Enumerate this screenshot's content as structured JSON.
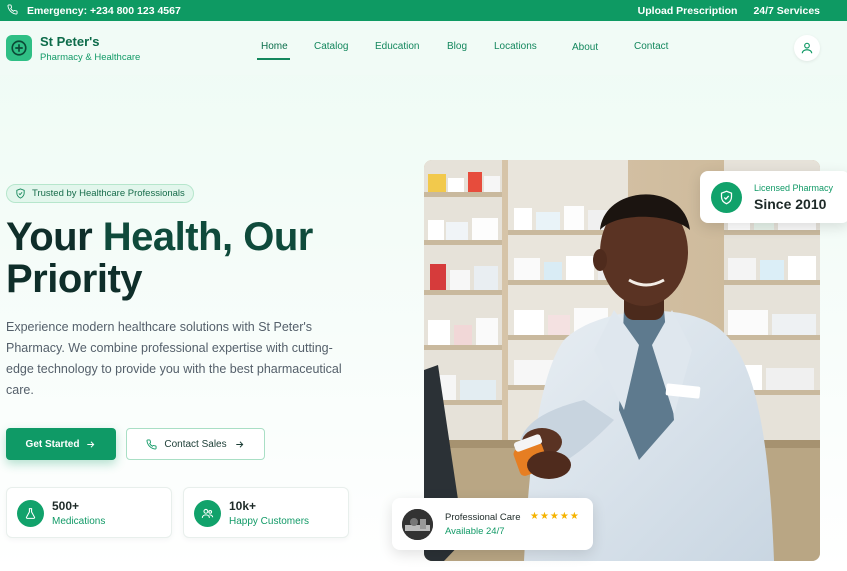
{
  "topbar": {
    "emergency": "Emergency: +234 800 123 4567",
    "upload": "Upload Prescription",
    "services": "24/7 Services"
  },
  "brand": {
    "name": "St Peter's",
    "tagline": "Pharmacy & Healthcare"
  },
  "nav": {
    "items": [
      {
        "label": "Home"
      },
      {
        "label": "Catalog"
      },
      {
        "label": "Education"
      },
      {
        "label": "Blog"
      },
      {
        "label": "Locations"
      },
      {
        "label": "About"
      },
      {
        "label": "Contact"
      }
    ],
    "active": "Home"
  },
  "hero": {
    "badge": "Trusted by Healthcare Professionals",
    "title_part1": "Your ",
    "title_part2": "Health, Our",
    "title_part3": "Priority",
    "description": "Experience modern healthcare solutions with St Peter's Pharmacy. We combine professional expertise with cutting-edge technology to provide you with the best pharmaceutical care.",
    "primary_cta": "Get Started",
    "secondary_cta": "Contact Sales"
  },
  "stats": [
    {
      "value": "500+",
      "label": "Medications",
      "icon": "flask-icon"
    },
    {
      "value": "10k+",
      "label": "Happy Customers",
      "icon": "users-icon"
    }
  ],
  "license_card": {
    "title": "Licensed Pharmacy",
    "value": "Since 2010"
  },
  "care_card": {
    "title": "Professional Care",
    "subtitle": "Available 24/7",
    "rating": 5
  },
  "colors": {
    "primary": "#0f9a66",
    "dark": "#0f2e2a",
    "star": "#f5b301"
  }
}
